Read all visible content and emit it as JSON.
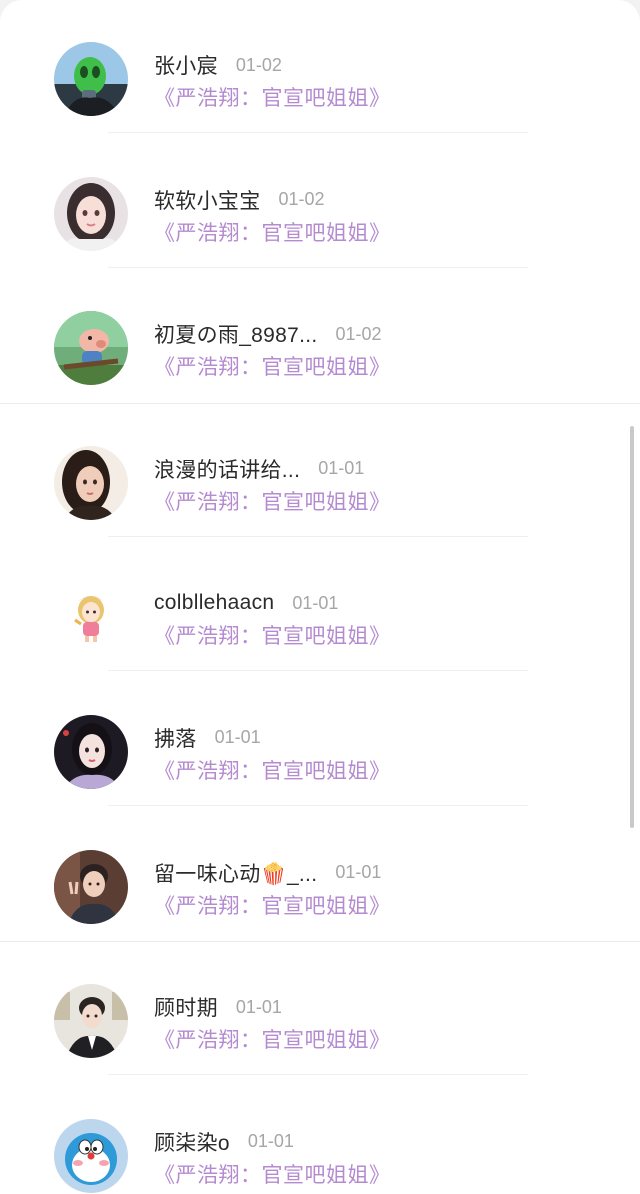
{
  "comments": [
    {
      "name": "张小宸",
      "date": "01-02",
      "topic": "《严浩翔：官宣吧姐姐》",
      "avatar_icon": "green-alien-mask-avatar"
    },
    {
      "name": "软软小宝宝",
      "date": "01-02",
      "topic": "《严浩翔：官宣吧姐姐》",
      "avatar_icon": "anime-girl-avatar"
    },
    {
      "name": "初夏の雨_8987...",
      "date": "01-02",
      "topic": "《严浩翔：官宣吧姐姐》",
      "avatar_icon": "cartoon-pig-avatar"
    },
    {
      "name": "浪漫的话讲给...",
      "date": "01-01",
      "topic": "《严浩翔：官宣吧姐姐》",
      "avatar_icon": "girl-photo-avatar"
    },
    {
      "name": "colbllehaacn",
      "date": "01-01",
      "topic": "《严浩翔：官宣吧姐姐》",
      "avatar_icon": "cartoon-girl-sticker-avatar"
    },
    {
      "name": "拂落",
      "date": "01-01",
      "topic": "《严浩翔：官宣吧姐姐》",
      "avatar_icon": "girl-portrait-avatar"
    },
    {
      "name": "留一味心动🍿_...",
      "date": "01-01",
      "topic": "《严浩翔：官宣吧姐姐》",
      "avatar_icon": "boy-peace-sign-avatar"
    },
    {
      "name": "顾时期",
      "date": "01-01",
      "topic": "《严浩翔：官宣吧姐姐》",
      "avatar_icon": "boy-in-suit-avatar"
    },
    {
      "name": "顾柒染o",
      "date": "01-01",
      "topic": "《严浩翔：官宣吧姐姐》",
      "avatar_icon": "doraemon-avatar"
    }
  ],
  "colors": {
    "topic": "#b48bd0",
    "name": "#2b2b2b",
    "date": "#a6a6a6"
  }
}
